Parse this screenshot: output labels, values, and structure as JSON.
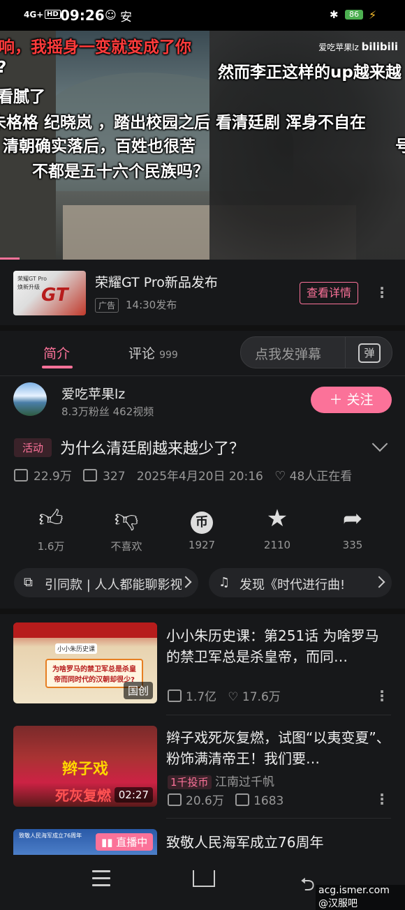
{
  "status_bar": {
    "time": "09:26",
    "network": "4G+",
    "hd": "HD",
    "battery": "86"
  },
  "video": {
    "watermark_user": "爱吃苹果lz",
    "watermark_brand": "bilibili",
    "danmaku": [
      "响，我摇身一变就变成了你",
      "然而李正这样的up越来越",
      "?",
      "看腻了",
      "未格格  纪晓岚  ，踏出校园之后  看清廷剧  浑身不自在",
      "清朝确实落后，百姓也很苦",
      "不都是五十六个民族吗？",
      "号"
    ],
    "progress": 0.05
  },
  "ad": {
    "thumb_label": "荣耀GT Pro",
    "thumb_sub": "焕新升级",
    "thumb_logo": "GT",
    "title": "荣耀GT Pro新品发布",
    "tag": "广告",
    "time": "14:30发布",
    "button": "查看详情"
  },
  "tabs": {
    "intro": "简介",
    "comments": "评论",
    "comments_count": "999",
    "danmaku_placeholder": "点我发弹幕",
    "danmaku_button": "弹"
  },
  "uploader": {
    "name": "爱吃苹果lz",
    "stats": "8.3万粉丝   462视频",
    "follow": "＋ 关注"
  },
  "video_info": {
    "badge": "活动",
    "title": "为什么清廷剧越来越少了？",
    "views": "22.9万",
    "danmaku_count": "327",
    "date": "2025年4月20日 20:16",
    "watching": "48人正在看"
  },
  "actions": [
    {
      "icon": "thumbs-up-icon",
      "label": "1.6万"
    },
    {
      "icon": "thumbs-down-icon",
      "label": "不喜欢"
    },
    {
      "icon": "coin-icon",
      "label": "1927"
    },
    {
      "icon": "star-icon",
      "label": "2110"
    },
    {
      "icon": "share-icon",
      "label": "335"
    }
  ],
  "pills": [
    {
      "icon": "video-edit-icon",
      "text": "引同款 | 人人都能聊影视"
    },
    {
      "icon": "music-note-icon",
      "text": "发现《时代进行曲!"
    }
  ],
  "related": [
    {
      "title": "小小朱历史课：第251话 为啥罗马的禁卫军总是杀皇帝，而同…",
      "thumb_text": "为啥罗马的禁卫军总是杀皇帝而同时代的汉朝却很少?",
      "thumb_tag": "小小朱历史课",
      "corner": "国创",
      "views": "1.7亿",
      "likes": "17.6万"
    },
    {
      "title": "辫子戏死灰复燃，试图“以夷变夏”、粉饰满清帝王！我们要…",
      "thumb_text1": "辫子戏",
      "thumb_text2": "死灰复燃",
      "corner": "02:27",
      "coin_badge": "1千投币",
      "author": "江南过千帆",
      "views": "20.6万",
      "danmaku": "1683"
    },
    {
      "title": "致敬人民海军成立76周年",
      "thumb_tag": "致敬人民海军成立76周年",
      "live_badge": "直播中"
    }
  ],
  "bottom_watermark": "acg.ismer.com  @汉服吧",
  "colors": {
    "accent": "#fb7299",
    "background": "#17181a"
  }
}
